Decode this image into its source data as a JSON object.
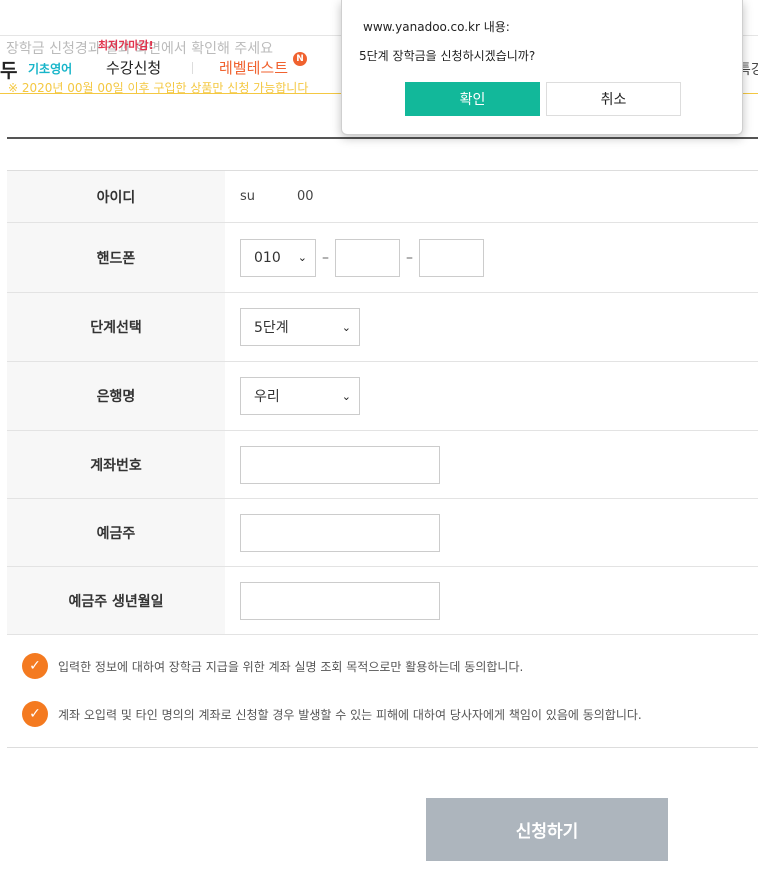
{
  "header": {
    "background_notice": "장학금 신청경과 결과 화면에서 확인해 주세요",
    "logo_text": "두",
    "logo_sub": "기초영어",
    "badge": "최저가마감!",
    "nav_course": "수강신청",
    "nav_level": "레벨테스트",
    "nav_level_badge": "N",
    "nav_right": "특강",
    "background_warning": "※ 2020년 00월 00일 이후 구입한 상품만 신청 가능합니다"
  },
  "form": {
    "id_label": "아이디",
    "id_value_start": "su",
    "id_value_end": "00",
    "phone_label": "핸드폰",
    "phone_prefix": "010",
    "phone_dash": "–",
    "step_label": "단계선택",
    "step_value": "5단계",
    "bank_label": "은행명",
    "bank_value": "우리",
    "account_label": "계좌번호",
    "holder_label": "예금주",
    "holder_birth_label": "예금주 생년월일"
  },
  "agreements": [
    "입력한 정보에 대하여 장학금 지급을 위한 계좌 실명 조회 목적으로만 활용하는데 동의합니다.",
    "계좌 오입력 및 타인 명의의 계좌로 신청할 경우 발생할 수 있는 피해에 대하여 당사자에게 책임이 있음에 동의합니다."
  ],
  "submit_label": "신청하기",
  "dialog": {
    "origin": "www.yanadoo.co.kr 내용:",
    "message": "5단계 장학금을 신청하시겠습니까?",
    "ok_label": "확인",
    "cancel_label": "취소"
  },
  "colors": {
    "accent_orange": "#f47a20",
    "dialog_ok": "#12b89a",
    "submit_disabled": "#adb5bd",
    "level_nav": "#f0622f"
  },
  "icons": {
    "check": "check-circle-icon",
    "select_arrow": "chevron-down-icon"
  }
}
